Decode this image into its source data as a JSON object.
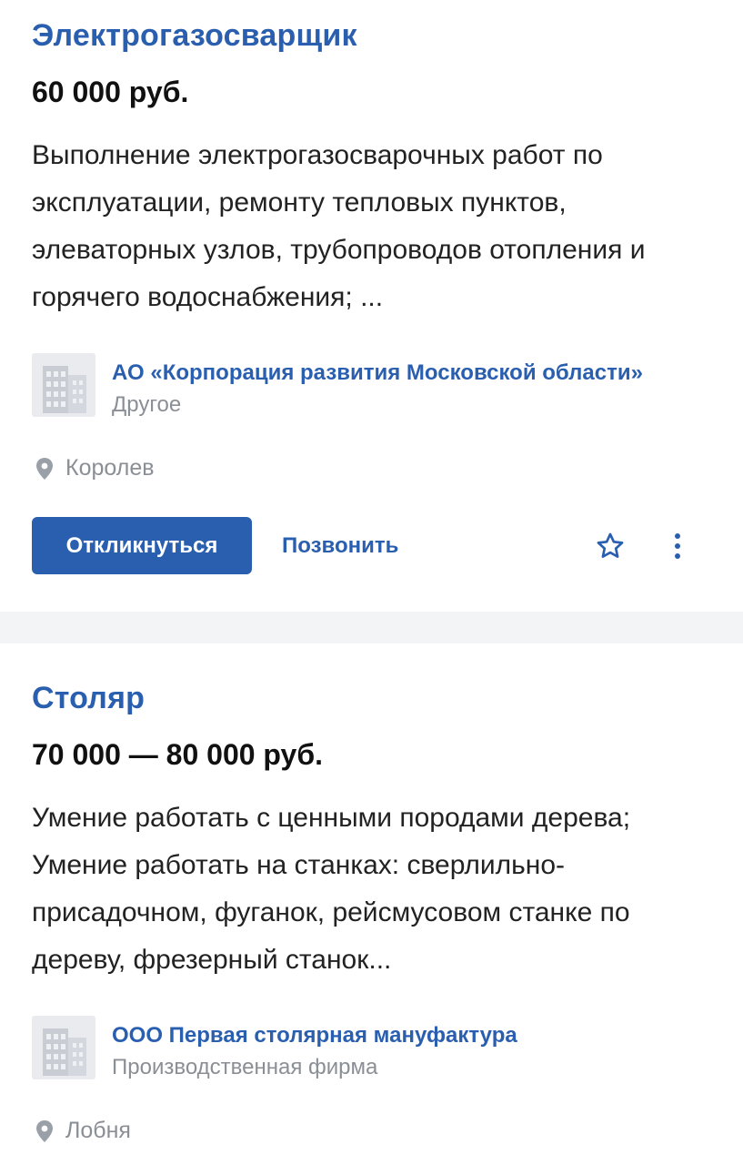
{
  "vacancies": [
    {
      "title": "Электрогазосварщик",
      "salary": "60 000 руб.",
      "description_lines": [
        "Выполнение электрогазосварочных работ по",
        "эксплуатации, ремонту тепловых пунктов,",
        "элеваторных узлов, трубопроводов отопления и",
        "горячего водоснабжения; ..."
      ],
      "company_name": "АО «Корпорация развития Московской области»",
      "company_type": "Другое",
      "location": "Королев",
      "respond_label": "Откликнуться",
      "call_label": "Позвонить"
    },
    {
      "title": "Столяр",
      "salary": "70 000 — 80 000 руб.",
      "description_lines": [
        "Умение работать с ценными породами дерева;",
        "Умение работать на станках: сверлильно-",
        "присадочном, фуганок, рейсмусовом станке по",
        "дереву, фрезерный станок..."
      ],
      "company_name": "ООО Первая столярная мануфактура",
      "company_type": "Производственная фирма",
      "location": "Лобня"
    }
  ],
  "icons": {
    "favorite": "star-outline-icon",
    "more": "kebab-menu-icon",
    "location": "map-pin-icon",
    "company": "building-icon"
  },
  "colors": {
    "accent": "#2a5fb0",
    "muted": "#8a8f96",
    "text": "#222222"
  }
}
